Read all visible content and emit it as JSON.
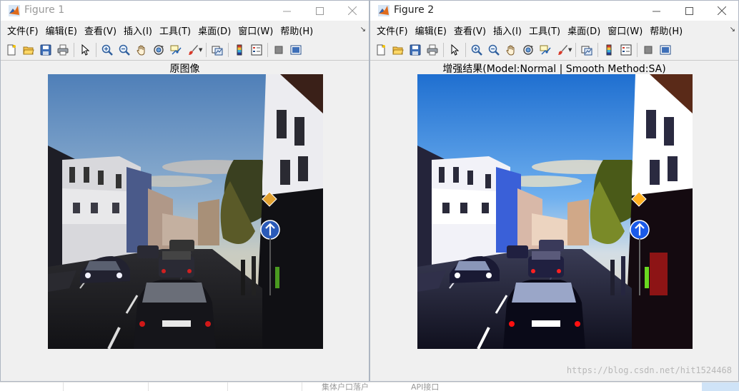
{
  "figure1": {
    "title": "Figure 1",
    "menu": [
      "文件(F)",
      "编辑(E)",
      "查看(V)",
      "插入(I)",
      "工具(T)",
      "桌面(D)",
      "窗口(W)",
      "帮助(H)"
    ],
    "axes_title": "原图像"
  },
  "figure2": {
    "title": "Figure 2",
    "menu": [
      "文件(F)",
      "编辑(E)",
      "查看(V)",
      "插入(I)",
      "工具(T)",
      "桌面(D)",
      "窗口(W)",
      "帮助(H)"
    ],
    "axes_title": "增强结果(Model:Normal | Smooth Method:SA)"
  },
  "toolbar_icons": [
    "new-figure-icon",
    "open-file-icon",
    "save-icon",
    "print-icon",
    "select-arrow-icon",
    "zoom-in-icon",
    "zoom-out-icon",
    "pan-hand-icon",
    "rotate-3d-icon",
    "data-cursor-icon",
    "brush-icon",
    "link-plot-icon",
    "colorbar-icon",
    "legend-icon",
    "hide-plot-tools-icon",
    "show-plot-tools-icon"
  ],
  "watermark": "https://blog.csdn.net/hit1524468",
  "taskbar": {
    "tab5": "集体户口落户",
    "tab6": "API接口"
  }
}
